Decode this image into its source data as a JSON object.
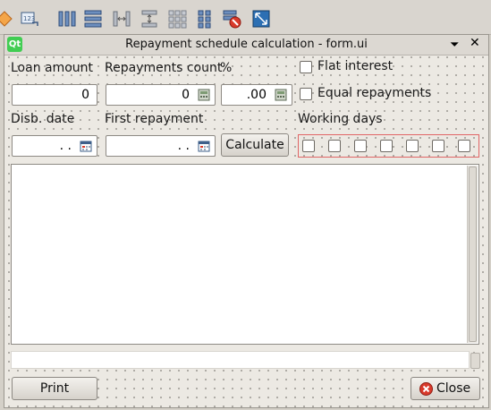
{
  "toolbar": {
    "items": [
      "edit-tab-order-icon",
      "edit-buddies-icon",
      "layout-horizontal-icon",
      "layout-vertical-icon",
      "layout-horizontal-splitter-icon",
      "layout-vertical-splitter-icon",
      "layout-grid-icon",
      "layout-form-icon",
      "break-layout-icon",
      "adjust-size-icon"
    ]
  },
  "window": {
    "title": "Repayment schedule calculation - form.ui",
    "menu_glyph": "⏷",
    "close_glyph": "✕"
  },
  "form": {
    "loan_amount_label": "Loan amount",
    "loan_amount_value": "0",
    "repayments_count_label": "Repayments count",
    "repayments_count_value": "0",
    "percent_label": "%",
    "percent_value": ".00",
    "flat_interest_label": "Flat interest",
    "equal_repayments_label": "Equal repayments",
    "disb_date_label": "Disb. date",
    "disb_date_value": ". .",
    "first_repayment_label": "First repayment",
    "first_repayment_value": ". .",
    "calculate_label": "Calculate",
    "working_days_label": "Working days",
    "working_days_count": 7,
    "print_label": "Print",
    "close_label": "Close"
  },
  "colors": {
    "accent_red": "#d93a2b",
    "working_days_border": "#e06666"
  }
}
